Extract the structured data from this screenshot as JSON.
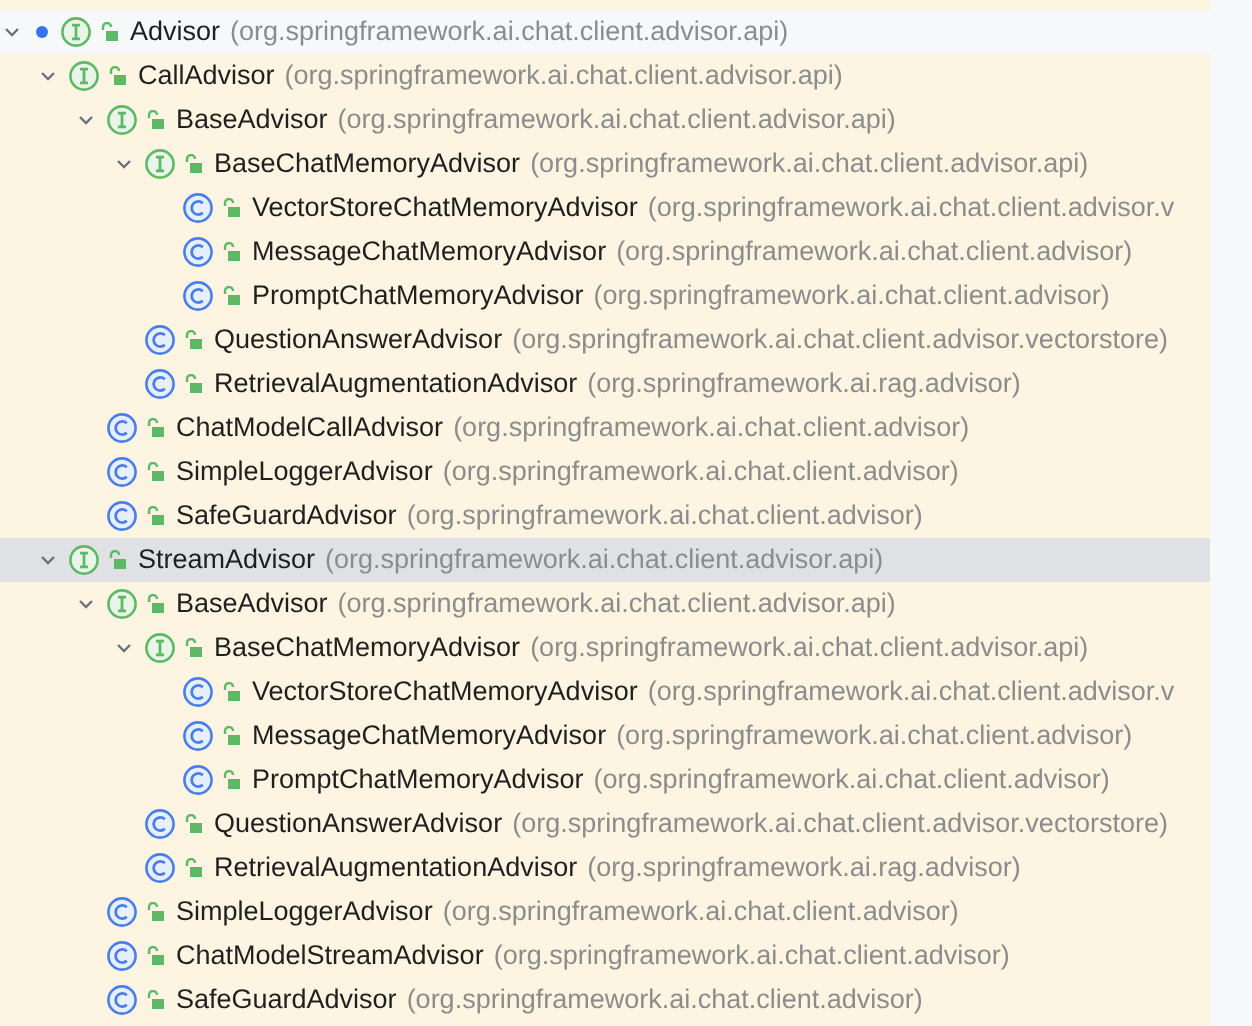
{
  "tree": [
    {
      "name": "Advisor",
      "package": "(org.springframework.ai.chat.client.advisor.api)",
      "kind": "interface",
      "marked": true,
      "expanded": true,
      "selected": false,
      "children": [
        {
          "name": "CallAdvisor",
          "package": "(org.springframework.ai.chat.client.advisor.api)",
          "kind": "interface",
          "expanded": true,
          "selected": false,
          "children": [
            {
              "name": "BaseAdvisor",
              "package": "(org.springframework.ai.chat.client.advisor.api)",
              "kind": "interface",
              "expanded": true,
              "selected": false,
              "children": [
                {
                  "name": "BaseChatMemoryAdvisor",
                  "package": "(org.springframework.ai.chat.client.advisor.api)",
                  "kind": "interface",
                  "expanded": true,
                  "selected": false,
                  "children": [
                    {
                      "name": "VectorStoreChatMemoryAdvisor",
                      "package": "(org.springframework.ai.chat.client.advisor.v",
                      "kind": "class",
                      "selected": false
                    },
                    {
                      "name": "MessageChatMemoryAdvisor",
                      "package": "(org.springframework.ai.chat.client.advisor)",
                      "kind": "class",
                      "selected": false
                    },
                    {
                      "name": "PromptChatMemoryAdvisor",
                      "package": "(org.springframework.ai.chat.client.advisor)",
                      "kind": "class",
                      "selected": false
                    }
                  ]
                },
                {
                  "name": "QuestionAnswerAdvisor",
                  "package": "(org.springframework.ai.chat.client.advisor.vectorstore)",
                  "kind": "class",
                  "selected": false
                },
                {
                  "name": "RetrievalAugmentationAdvisor",
                  "package": "(org.springframework.ai.rag.advisor)",
                  "kind": "class",
                  "selected": false
                }
              ]
            },
            {
              "name": "ChatModelCallAdvisor",
              "package": "(org.springframework.ai.chat.client.advisor)",
              "kind": "class",
              "selected": false
            },
            {
              "name": "SimpleLoggerAdvisor",
              "package": "(org.springframework.ai.chat.client.advisor)",
              "kind": "class",
              "selected": false
            },
            {
              "name": "SafeGuardAdvisor",
              "package": "(org.springframework.ai.chat.client.advisor)",
              "kind": "class",
              "selected": false
            }
          ]
        },
        {
          "name": "StreamAdvisor",
          "package": "(org.springframework.ai.chat.client.advisor.api)",
          "kind": "interface",
          "expanded": true,
          "selected": true,
          "children": [
            {
              "name": "BaseAdvisor",
              "package": "(org.springframework.ai.chat.client.advisor.api)",
              "kind": "interface",
              "expanded": true,
              "selected": false,
              "children": [
                {
                  "name": "BaseChatMemoryAdvisor",
                  "package": "(org.springframework.ai.chat.client.advisor.api)",
                  "kind": "interface",
                  "expanded": true,
                  "selected": false,
                  "children": [
                    {
                      "name": "VectorStoreChatMemoryAdvisor",
                      "package": "(org.springframework.ai.chat.client.advisor.v",
                      "kind": "class",
                      "selected": false
                    },
                    {
                      "name": "MessageChatMemoryAdvisor",
                      "package": "(org.springframework.ai.chat.client.advisor)",
                      "kind": "class",
                      "selected": false
                    },
                    {
                      "name": "PromptChatMemoryAdvisor",
                      "package": "(org.springframework.ai.chat.client.advisor)",
                      "kind": "class",
                      "selected": false
                    }
                  ]
                },
                {
                  "name": "QuestionAnswerAdvisor",
                  "package": "(org.springframework.ai.chat.client.advisor.vectorstore)",
                  "kind": "class",
                  "selected": false
                },
                {
                  "name": "RetrievalAugmentationAdvisor",
                  "package": "(org.springframework.ai.rag.advisor)",
                  "kind": "class",
                  "selected": false
                }
              ]
            },
            {
              "name": "SimpleLoggerAdvisor",
              "package": "(org.springframework.ai.chat.client.advisor)",
              "kind": "class",
              "selected": false
            },
            {
              "name": "ChatModelStreamAdvisor",
              "package": "(org.springframework.ai.chat.client.advisor)",
              "kind": "class",
              "selected": false
            },
            {
              "name": "SafeGuardAdvisor",
              "package": "(org.springframework.ai.chat.client.advisor)",
              "kind": "class",
              "selected": false
            }
          ]
        }
      ]
    }
  ]
}
